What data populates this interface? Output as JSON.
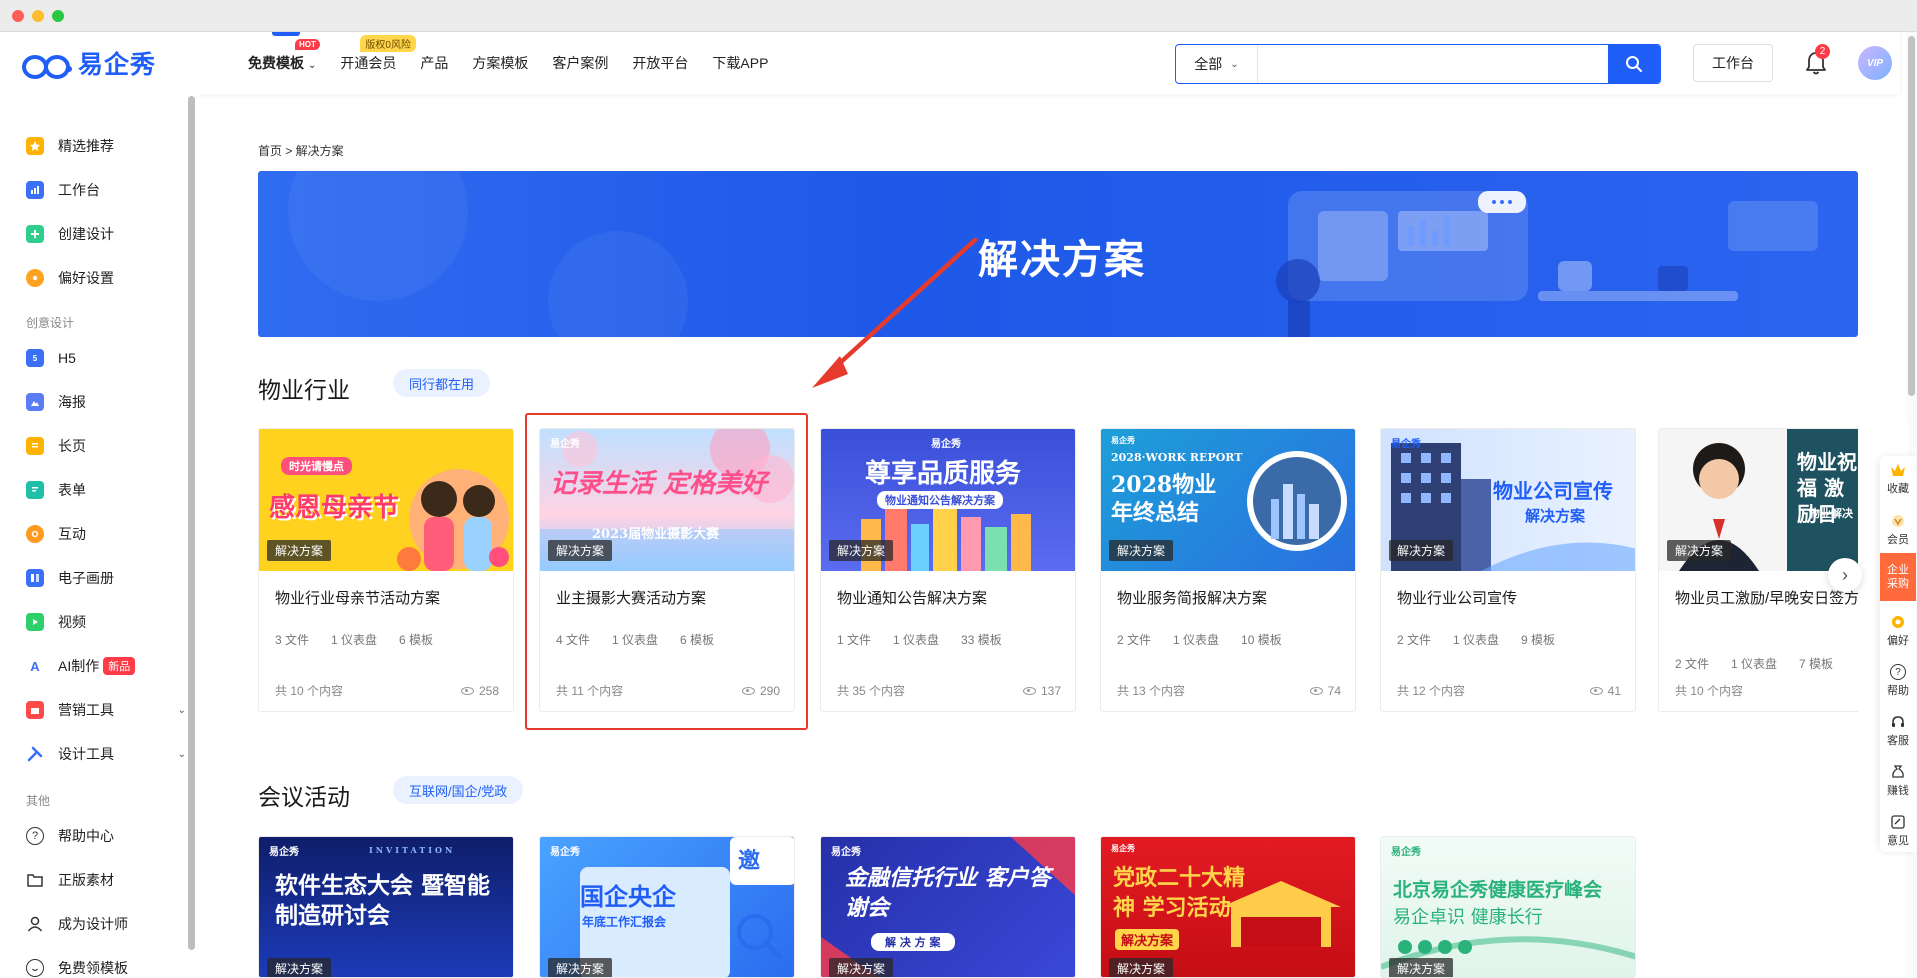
{
  "brand": {
    "name": "易企秀"
  },
  "nav": {
    "items": [
      {
        "label": "免费模板",
        "badge": "HOT"
      },
      {
        "label": "开通会员",
        "badge": "版权0风险"
      },
      {
        "label": "产品"
      },
      {
        "label": "方案模板"
      },
      {
        "label": "客户案例"
      },
      {
        "label": "开放平台"
      },
      {
        "label": "下载APP"
      }
    ]
  },
  "search": {
    "scope": "全部",
    "placeholder": "",
    "button_icon": "search-icon"
  },
  "header": {
    "workbench_label": "工作台",
    "notification_count": "2",
    "avatar_label": "VIP"
  },
  "sidebar": {
    "items_top": [
      {
        "label": "精选推荐",
        "icon": "star-icon",
        "color": "#ffb300"
      },
      {
        "label": "工作台",
        "icon": "chart-icon",
        "color": "#3a6ff7"
      },
      {
        "label": "创建设计",
        "icon": "plus-icon",
        "color": "#2fcf8b"
      },
      {
        "label": "偏好设置",
        "icon": "gear-icon",
        "color": "#ffa21f"
      }
    ],
    "section_creative": "创意设计",
    "items_creative": [
      {
        "label": "H5",
        "icon": "h5-icon",
        "color": "#3a6ff7"
      },
      {
        "label": "海报",
        "icon": "image-icon",
        "color": "#5b7cf7"
      },
      {
        "label": "长页",
        "icon": "longpage-icon",
        "color": "#ffb300"
      },
      {
        "label": "表单",
        "icon": "form-icon",
        "color": "#1fbfa8"
      },
      {
        "label": "互动",
        "icon": "interact-icon",
        "color": "#ff9a1f"
      },
      {
        "label": "电子画册",
        "icon": "album-icon",
        "color": "#3a6ff7"
      },
      {
        "label": "视频",
        "icon": "video-icon",
        "color": "#2fcf6b"
      },
      {
        "label": "AI制作",
        "icon": "ai-icon",
        "color": "#3a6ff7",
        "badge": "新品"
      },
      {
        "label": "营销工具",
        "icon": "marketing-icon",
        "color": "#ff4a4a",
        "expand": true
      },
      {
        "label": "设计工具",
        "icon": "design-tool-icon",
        "color": "#3a6ff7",
        "expand": true
      }
    ],
    "section_other": "其他",
    "items_other": [
      {
        "label": "帮助中心",
        "icon": "help-icon",
        "color": "#333"
      },
      {
        "label": "正版素材",
        "icon": "folder-icon",
        "color": "#333"
      },
      {
        "label": "成为设计师",
        "icon": "user-icon",
        "color": "#333"
      },
      {
        "label": "免费领模板",
        "icon": "smile-icon",
        "color": "#333"
      }
    ]
  },
  "breadcrumb": "首页 > 解决方案",
  "banner": {
    "title": "解决方案"
  },
  "sections": [
    {
      "title": "物业行业",
      "tag": "同行都在用",
      "cards": [
        {
          "title": "物业行业母亲节活动方案",
          "files": "3 文件",
          "dashboards": "1 仪表盘",
          "templates": "6 模板",
          "total": "共 10 个内容",
          "views": "258",
          "tag": "解决方案",
          "img_text": "感恩母亲节",
          "img_sub": "时光请慢点"
        },
        {
          "title": "业主摄影大赛活动方案",
          "files": "4 文件",
          "dashboards": "1 仪表盘",
          "templates": "6 模板",
          "total": "共 11 个内容",
          "views": "290",
          "tag": "解决方案",
          "img_text": "记录生活 定格美好",
          "img_sub": "2023届物业摄影大赛"
        },
        {
          "title": "物业通知公告解决方案",
          "files": "1 文件",
          "dashboards": "1 仪表盘",
          "templates": "33 模板",
          "total": "共 35 个内容",
          "views": "137",
          "tag": "解决方案",
          "img_text": "尊享品质服务",
          "img_sub": "物业通知公告解决方案"
        },
        {
          "title": "物业服务简报解决方案",
          "files": "2 文件",
          "dashboards": "1 仪表盘",
          "templates": "10 模板",
          "total": "共 13 个内容",
          "views": "74",
          "tag": "解决方案",
          "img_text": "2028物业 年终总结",
          "img_sub": "2028·WORK REPORT"
        },
        {
          "title": "物业行业公司宣传",
          "files": "2 文件",
          "dashboards": "1 仪表盘",
          "templates": "9 模板",
          "total": "共 12 个内容",
          "views": "41",
          "tag": "解决方案",
          "img_text": "物业公司宣传",
          "img_sub": "解决方案"
        },
        {
          "title": "物业员工激励/早晚安日签方案",
          "files": "2 文件",
          "dashboards": "1 仪表盘",
          "templates": "7 模板",
          "total": "共 10 个内容",
          "views": "",
          "tag": "解决方案",
          "img_text": "物业祝福 激励日",
          "img_sub": "物业解决"
        }
      ]
    },
    {
      "title": "会议活动",
      "tag": "互联网/国企/党政",
      "cards": [
        {
          "tag": "解决方案",
          "img_text": "软件生态大会 暨智能制造研讨会",
          "img_sub": "INVITATION"
        },
        {
          "tag": "解决方案",
          "img_text": "国企央企",
          "img_sub": "年底工作汇报会"
        },
        {
          "tag": "解决方案",
          "img_text": "金融信托行业 客户答谢会",
          "img_sub": "解 决 方 案"
        },
        {
          "tag": "解决方案",
          "img_text": "党政二十大精神 学习活动",
          "img_sub": "解决方案"
        },
        {
          "tag": "解决方案",
          "img_text": "北京易企秀健康医疗峰会",
          "img_sub": "易企卓识 健康长行"
        }
      ]
    }
  ],
  "float_bar": [
    {
      "label": "收藏",
      "icon": "crown-icon"
    },
    {
      "label": "会员",
      "icon": "vip-icon"
    },
    {
      "label": "企业采购",
      "icon": "enterprise-icon"
    },
    {
      "label": "偏好",
      "icon": "gear-icon"
    },
    {
      "label": "帮助",
      "icon": "help-icon"
    },
    {
      "label": "客服",
      "icon": "headset-icon"
    },
    {
      "label": "赚钱",
      "icon": "money-icon"
    },
    {
      "label": "意见",
      "icon": "feedback-icon"
    }
  ]
}
